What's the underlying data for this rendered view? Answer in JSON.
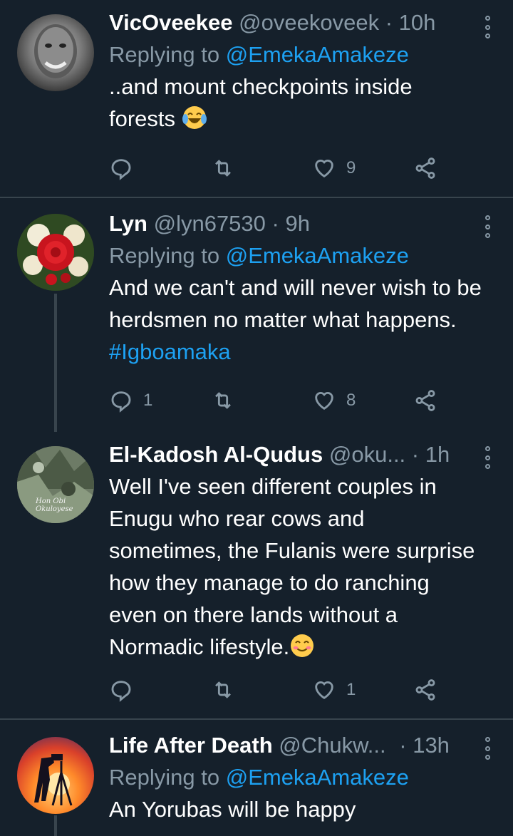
{
  "tweets": [
    {
      "name": "VicOveekee",
      "handle": "@oveekoveek",
      "time": "· 10h",
      "reply_prefix": "Replying to ",
      "reply_to": "@EmekaAmakeze",
      "text": "..and mount checkpoints inside forests",
      "emoji": "laughing-crying-emoji",
      "reply_count": "",
      "retweet_count": "",
      "like_count": "9"
    },
    {
      "name": "Lyn",
      "handle": "@lyn67530",
      "time": "· 9h",
      "reply_prefix": "Replying to ",
      "reply_to": "@EmekaAmakeze",
      "text": "And we can't and will never wish to be herdsmen no matter what happens. ",
      "hashtag": "#Igboamaka",
      "reply_count": "1",
      "retweet_count": "",
      "like_count": "8"
    },
    {
      "name": "El-Kadosh Al-Qudus",
      "handle": "@oku...",
      "time": "· 1h",
      "avatar_text": "Hon Obi Okuloyese",
      "text": "Well I've seen different couples in Enugu who rear cows and sometimes, the Fulanis were surprise how they manage to do ranching even on there lands without a Normadic lifestyle.",
      "emoji": "smiling-emoji",
      "reply_count": "",
      "retweet_count": "",
      "like_count": "1"
    },
    {
      "name": "Life After Death",
      "handle": "@Chukw...",
      "time": "· 13h",
      "reply_prefix": "Replying to ",
      "reply_to": "@EmekaAmakeze",
      "text": "An Yorubas will be happy"
    }
  ],
  "colors": {
    "background": "#15202b",
    "secondary_text": "#8899a6",
    "link": "#1da1f2",
    "divider": "#38444d"
  }
}
